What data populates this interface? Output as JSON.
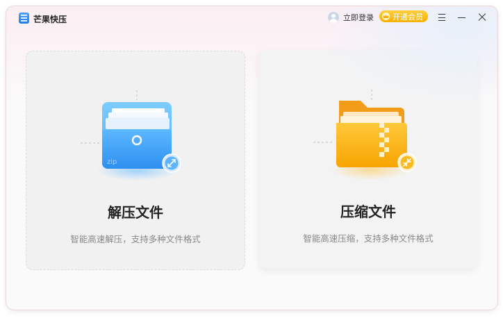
{
  "window": {
    "title": "芒果快压"
  },
  "header": {
    "login_label": "立即登录",
    "vip_label": "开通会员"
  },
  "cards": [
    {
      "title": "解压文件",
      "description": "智能高速解压，支持多种文件格式",
      "badge_text": "zip",
      "icon": "zip-archive-icon"
    },
    {
      "title": "压缩文件",
      "description": "智能高速压缩，支持多种文件格式",
      "icon": "zip-folder-icon"
    }
  ],
  "colors": {
    "accent_blue": "#3f9cf6",
    "accent_orange": "#f7a900",
    "vip_gold": "#f6b200"
  }
}
